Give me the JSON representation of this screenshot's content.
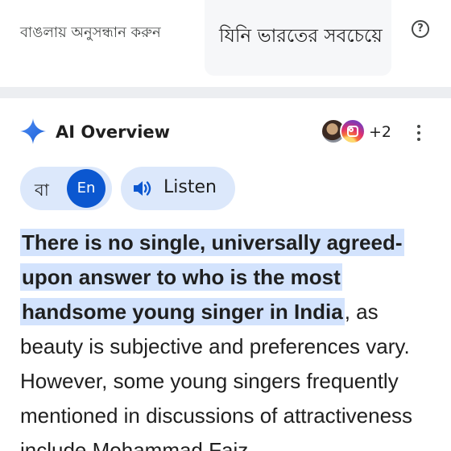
{
  "header": {
    "search_in_bengali_label": "বাঙলায় অনুসন্ধান করুন",
    "query_text": "যিনি ভারতের সবচেয়ে",
    "help_icon": "help-circle-icon"
  },
  "ai_overview": {
    "title": "AI Overview",
    "sparkle_icon": "sparkle-icon",
    "sources_more": "+2",
    "menu_icon": "more-vert-icon",
    "language": {
      "bengali_label": "বা",
      "english_label": "En",
      "active": "En"
    },
    "listen_label": "Listen",
    "answer": {
      "highlighted": "There is no single, universally agreed-upon answer to who is the most handsome young singer in India",
      "rest": ", as beauty is subjective and preferences vary. However, some young singers frequently mentioned in discussions of attractiveness include Mohammad Faiz"
    }
  },
  "colors": {
    "accent": "#0b57d0",
    "chip_background": "#dce8fb",
    "highlight": "#d3e3fd",
    "divider": "#eceef1"
  }
}
